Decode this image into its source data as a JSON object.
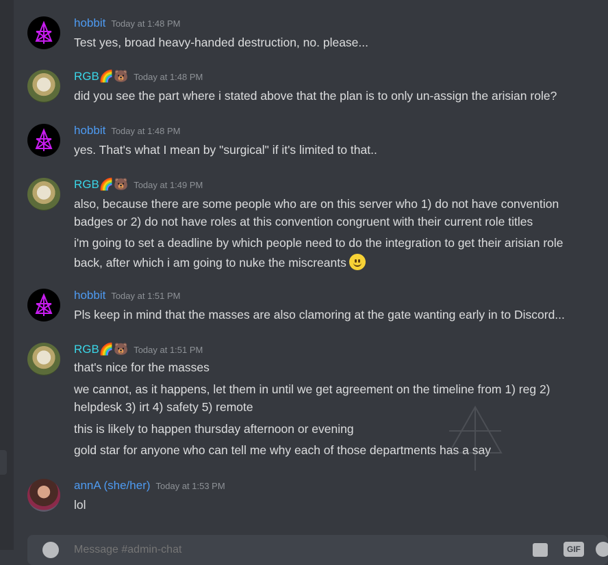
{
  "messages": [
    {
      "author": "hobbit",
      "author_badge": "",
      "timestamp": "Today at 1:48 PM",
      "lines": [
        "Test yes, broad heavy-handed destruction, no.  please..."
      ]
    },
    {
      "author": "RGB",
      "author_badge": "🌈🐻",
      "timestamp": "Today at 1:48 PM",
      "lines": [
        "did you see the part where i stated above that the plan is to only un-assign the arisian role?"
      ]
    },
    {
      "author": "hobbit",
      "author_badge": "",
      "timestamp": "Today at 1:48 PM",
      "lines": [
        "yes.  That's what I mean by \"surgical\" if it's limited to that.."
      ]
    },
    {
      "author": "RGB",
      "author_badge": "🌈🐻",
      "timestamp": "Today at 1:49 PM",
      "lines": [
        "also, because there are some people who are on this server who 1) do not have convention",
        "badges or 2) do not have roles at this convention congruent with their current role titles",
        "i'm going to set a deadline by which people need to do the integration to get their arisian role",
        "back, after which i am going to nuke the miscreants"
      ]
    },
    {
      "author": "hobbit",
      "author_badge": "",
      "timestamp": "Today at 1:51 PM",
      "lines": [
        "Pls keep in mind that the masses are also clamoring at the gate wanting early in to Discord..."
      ]
    },
    {
      "author": "RGB",
      "author_badge": "🌈🐻",
      "timestamp": "Today at 1:51 PM",
      "lines": [
        "that's nice for the masses",
        "we cannot, as it happens, let them in until we get agreement on the timeline from 1) reg 2)",
        "helpdesk 3) irt 4) safety 5) remote",
        "this is likely to happen thursday afternoon or evening",
        "gold star for anyone who can tell me why each of those departments has a say"
      ]
    },
    {
      "author": "annA (she/her)",
      "author_badge": "",
      "timestamp": "Today at 1:53 PM",
      "lines": [
        "lol"
      ]
    }
  ],
  "composer": {
    "placeholder": "Message #admin-chat",
    "gif_label": "GIF"
  },
  "icons": {
    "hobbit_avatar": "pentagram-avatar",
    "smiley": "slightly-smiling-face-emoji"
  },
  "colors": {
    "background": "#36393f",
    "hobbit_name": "#4e9bf2",
    "rgb_name": "#3ad6e8",
    "text": "#dcddde",
    "timestamp": "#8e9297"
  }
}
